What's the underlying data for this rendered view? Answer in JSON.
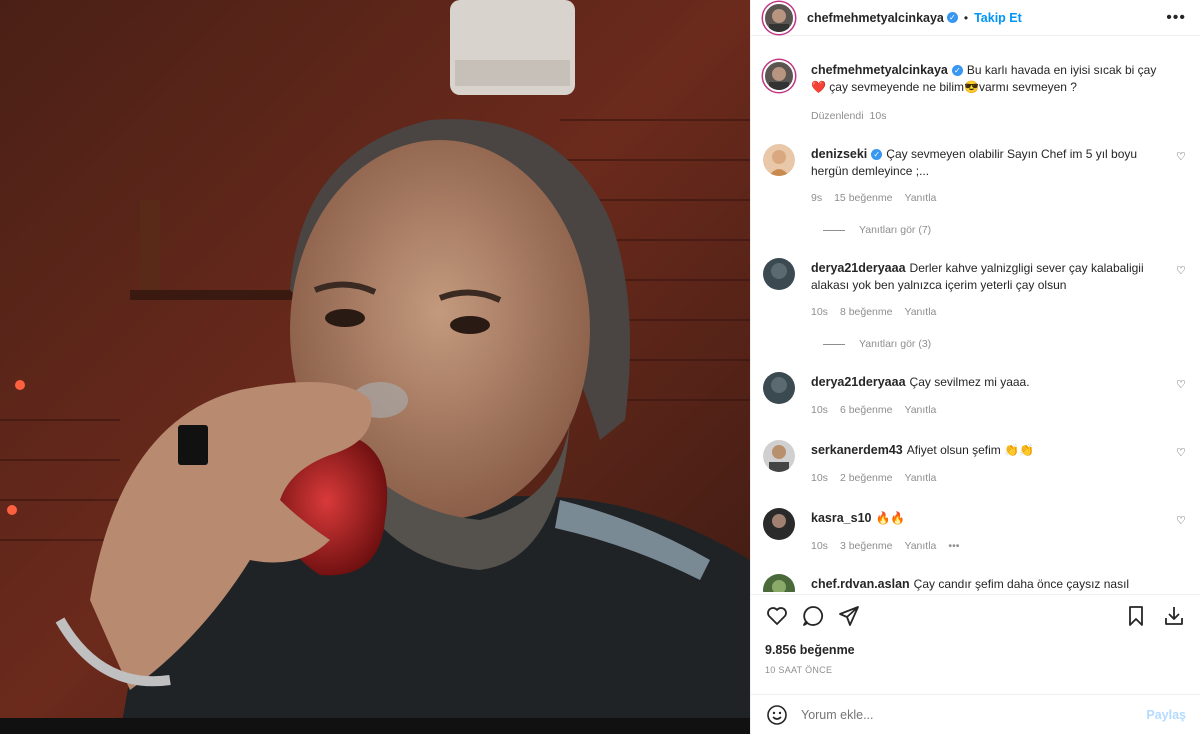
{
  "post": {
    "username": "chefmehmetyalcinkaya",
    "follow_label": "Takip Et",
    "more_label": "•••"
  },
  "caption": {
    "username": "chefmehmetyalcinkaya",
    "text": "Bu karlı havada en iyisi sıcak bi çay ❤️ çay sevmeyende ne bilim😎varmı sevmeyen ?",
    "edited": "Düzenlendi",
    "age": "10s"
  },
  "comments": [
    {
      "username": "denizseki",
      "verified": true,
      "text": "Çay sevmeyen olabilir Sayın Chef im 5 yıl boyu hergün demleyince ;...",
      "age": "9s",
      "likes": "15 beğenme",
      "reply": "Yanıtla",
      "view_replies": "Yanıtları gör (7)"
    },
    {
      "username": "derya21deryaaa",
      "text": "Derler kahve yalnizgligi sever çay kalabaligii alakası yok ben yalnızca içerim yeterli çay olsun",
      "age": "10s",
      "likes": "8 beğenme",
      "reply": "Yanıtla",
      "view_replies": "Yanıtları gör (3)"
    },
    {
      "username": "derya21deryaaa",
      "text": "Çay sevilmez mi yaaa.",
      "age": "10s",
      "likes": "6 beğenme",
      "reply": "Yanıtla"
    },
    {
      "username": "serkanerdem43",
      "text": "Afiyet olsun şefim 👏👏",
      "age": "10s",
      "likes": "2 beğenme",
      "reply": "Yanıtla"
    },
    {
      "username": "kasra_s10",
      "text": "🔥🔥",
      "age": "10s",
      "likes": "3 beğenme",
      "reply": "Yanıtla",
      "more": "•••"
    },
    {
      "username": "chef.rdvan.aslan",
      "text": "Çay candır şefim daha önce çaysız nasıl"
    }
  ],
  "engagement": {
    "likes": "9.856 beğenme",
    "time_ago": "10 SAAT ÖNCE"
  },
  "add_comment": {
    "placeholder": "Yorum ekle...",
    "share_label": "Paylaş"
  },
  "colors": {
    "accent": "#0095f6",
    "text": "#262626",
    "muted": "#8e8e8e",
    "share_disabled": "#b3dbff"
  },
  "icons": [
    "heart-icon",
    "comment-icon",
    "share-icon",
    "bookmark-icon",
    "save-icon",
    "emoji-icon",
    "verified-icon",
    "more-icon"
  ]
}
